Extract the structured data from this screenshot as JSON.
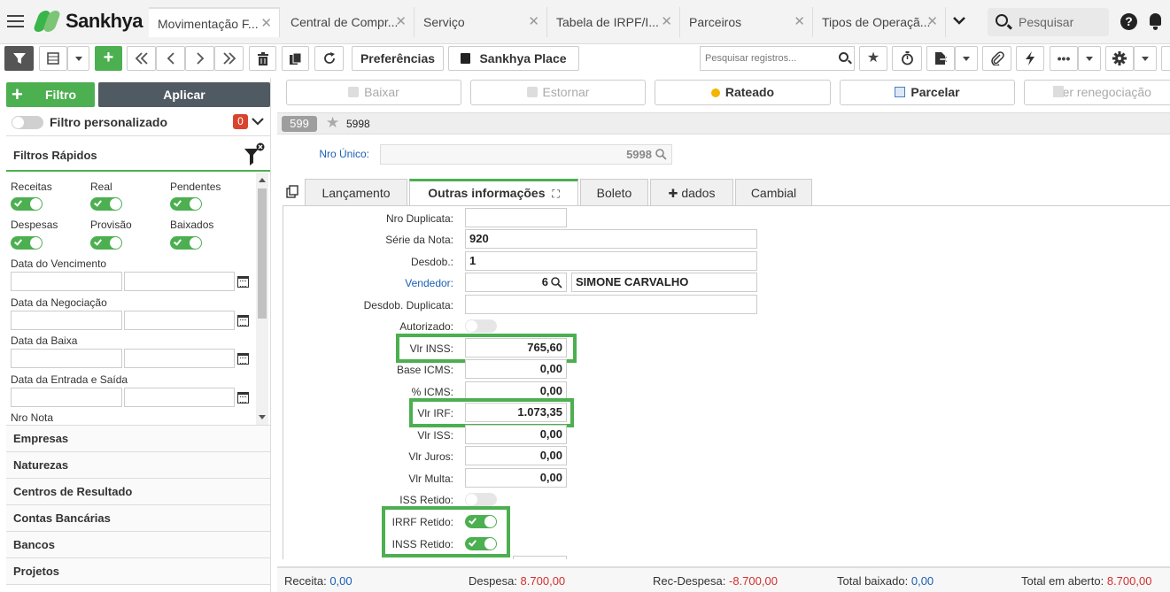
{
  "app": {
    "brand": "Sankhya"
  },
  "tabs": [
    {
      "label": "Movimentação F...",
      "active": true
    },
    {
      "label": "Central de Compr..."
    },
    {
      "label": "Serviço"
    },
    {
      "label": "Tabela de IRPF/I..."
    },
    {
      "label": "Parceiros"
    },
    {
      "label": "Tipos de Operaçã..."
    }
  ],
  "topsearch": {
    "placeholder": "Pesquisar"
  },
  "toolbar": {
    "preferences": "Preferências",
    "place": "Sankhya Place",
    "search_placeholder": "Pesquisar registros..."
  },
  "left": {
    "filtro": "Filtro",
    "aplicar": "Aplicar",
    "custom_filter": "Filtro personalizado",
    "custom_count": "0",
    "quick_title": "Filtros Rápidos",
    "toggles": [
      "Receitas",
      "Real",
      "Pendentes",
      "Despesas",
      "Provisão",
      "Baixados"
    ],
    "dates": [
      "Data do Vencimento",
      "Data da Negociação",
      "Data da Baixa",
      "Data da Entrada e Saída"
    ],
    "nro_nota": "Nro Nota",
    "sections": [
      "Empresas",
      "Naturezas",
      "Centros de Resultado",
      "Contas Bancárias",
      "Bancos",
      "Projetos"
    ]
  },
  "actions": {
    "baixar": "Baixar",
    "estornar": "Estornar",
    "rateado": "Rateado",
    "parcelar": "Parcelar",
    "renegociacao": "Ver renegociação"
  },
  "record": {
    "badge": "599",
    "id": "5998",
    "nro_unico_label": "Nro Único:",
    "nro_unico": "5998"
  },
  "subtabs": [
    "Lançamento",
    "Outras informações",
    "Boleto",
    "dados",
    "Cambial"
  ],
  "form": {
    "nro_duplicata": {
      "label": "Nro Duplicata:",
      "value": ""
    },
    "serie": {
      "label": "Série da Nota:",
      "value": "920"
    },
    "desdob": {
      "label": "Desdob.:",
      "value": "1"
    },
    "vendedor": {
      "label": "Vendedor:",
      "code": "6",
      "name": "SIMONE CARVALHO"
    },
    "desdob_dup": {
      "label": "Desdob. Duplicata:",
      "value": ""
    },
    "autorizado": {
      "label": "Autorizado:"
    },
    "vlr_inss": {
      "label": "Vlr INSS:",
      "value": "765,60"
    },
    "base_icms": {
      "label": "Base ICMS:",
      "value": "0,00"
    },
    "pct_icms": {
      "label": "% ICMS:",
      "value": "0,00"
    },
    "vlr_irf": {
      "label": "Vlr IRF:",
      "value": "1.073,35"
    },
    "vlr_iss": {
      "label": "Vlr ISS:",
      "value": "0,00"
    },
    "vlr_juros": {
      "label": "Vlr Juros:",
      "value": "0,00"
    },
    "vlr_multa": {
      "label": "Vlr Multa:",
      "value": "0,00"
    },
    "iss_retido": {
      "label": "ISS Retido:"
    },
    "irrf_retido": {
      "label": "IRRF Retido:"
    },
    "inss_retido": {
      "label": "INSS Retido:"
    }
  },
  "status": {
    "receita_label": "Receita:",
    "receita": "0,00",
    "despesa_label": "Despesa:",
    "despesa": "8.700,00",
    "rec_despesa_label": "Rec-Despesa:",
    "rec_despesa": "-8.700,00",
    "total_baixado_label": "Total baixado:",
    "total_baixado": "0,00",
    "total_aberto_label": "Total em aberto:",
    "total_aberto": "8.700,00"
  },
  "colors": {
    "accent": "#4caf50",
    "dark": "#505a63",
    "link": "#1a5fb4",
    "negative": "#d32f2f",
    "positive": "#1a5fb4"
  }
}
